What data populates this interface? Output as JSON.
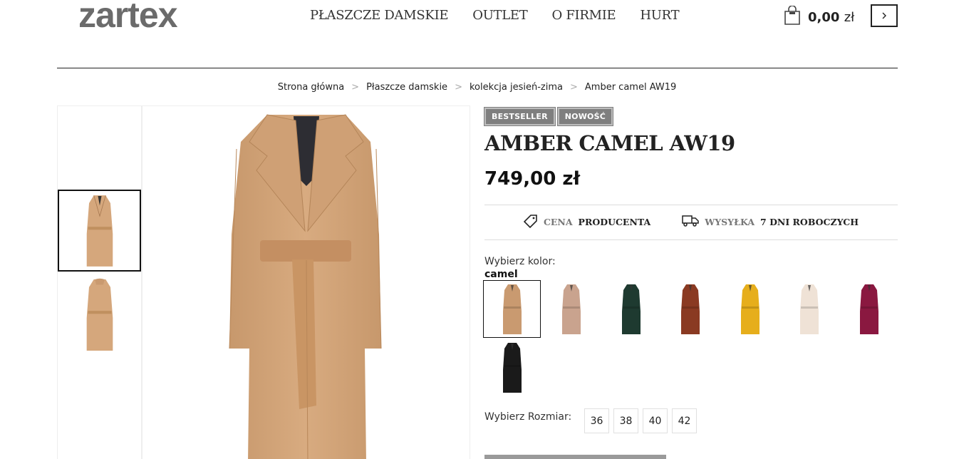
{
  "brand": {
    "logo": "zartex"
  },
  "nav": {
    "items": [
      "PŁASZCZE DAMSKIE",
      "OUTLET",
      "O FIRMIE",
      "HURT"
    ]
  },
  "cart": {
    "amount": "0,00",
    "currency": "zł",
    "icon": "shopping-bag-icon"
  },
  "breadcrumb": {
    "items": [
      "Strona główna",
      "Płaszcze damskie",
      "kolekcja jesień-zima",
      "Amber camel AW19"
    ],
    "separator": ">"
  },
  "product": {
    "badges": [
      "BESTSELLER",
      "NOWOŚĆ"
    ],
    "title": "AMBER CAMEL AW19",
    "price": "749,00 zł",
    "features": [
      {
        "light": "CENA",
        "dark": "PRODUCENTA",
        "icon": "price-tag-icon"
      },
      {
        "light": "WYSYŁKA",
        "dark": "7 DNI ROBOCZYCH",
        "icon": "delivery-truck-icon"
      }
    ],
    "color_label": "Wybierz kolor:",
    "color_selected": "camel",
    "colors": [
      "#c99a70",
      "#c9a38e",
      "#1e3a30",
      "#8a3a22",
      "#e6ae1c",
      "#efe2d6",
      "#8a1840",
      "#1a1a1a"
    ],
    "size_label": "Wybierz Rozmiar:",
    "sizes": [
      "36",
      "38",
      "40",
      "42"
    ]
  },
  "colors": {
    "coat": "#d5a77c",
    "badge": "#7f7f7f"
  }
}
